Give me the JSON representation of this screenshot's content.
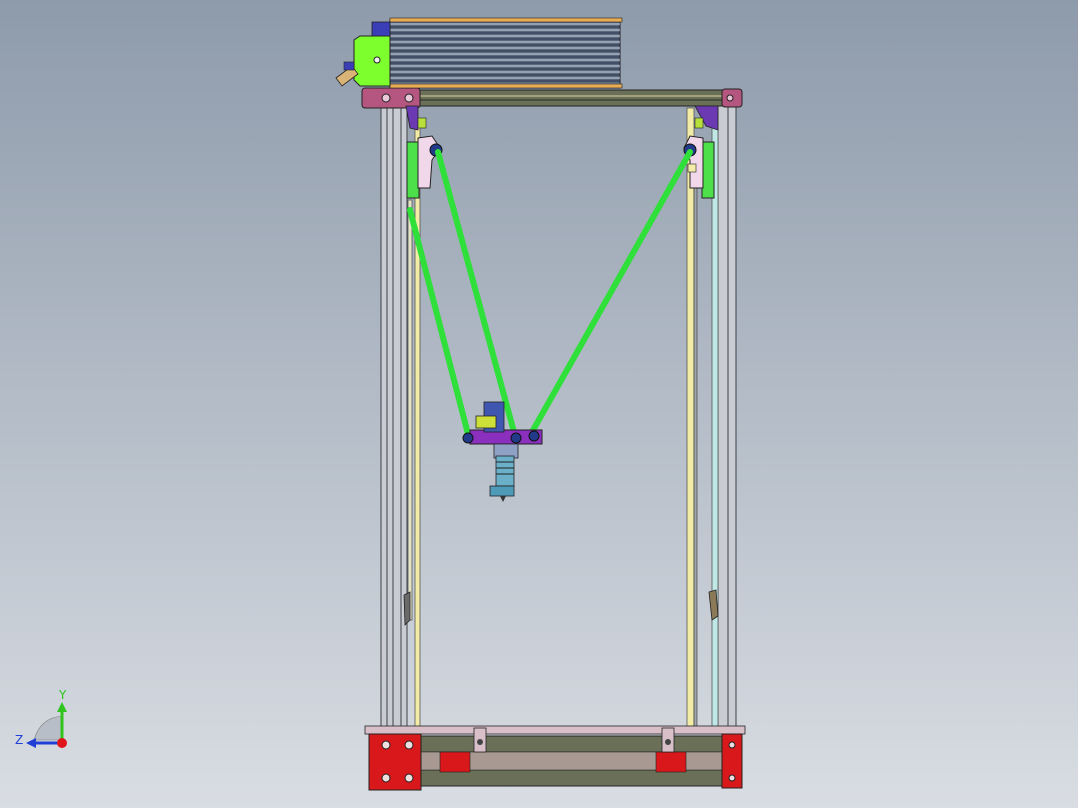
{
  "viewport": {
    "background_top": "#8e9bab",
    "background_bottom": "#d9dde3"
  },
  "triad": {
    "y_label": "Y",
    "z_label": "Z",
    "y_color": "#2fc41e",
    "z_color": "#1f3fd6",
    "x_color": "#e0161b"
  },
  "colors": {
    "arm": "#2fe03a",
    "arm_edge": "#116a18",
    "upright": "#c9ccd2",
    "upright_dark": "#3d4148",
    "rail": "#f2eca6",
    "rail_right": "#bfe8e6",
    "bracket_top": "#b4567f",
    "base": "#d8181b",
    "extrusion": "#6a7057",
    "carriage_green": "#4ee04a",
    "carriage_pink": "#f0d7ea",
    "effector": "#8b2fbf",
    "spool_body": "#5c6a80",
    "spool_edge": "#e8ad54",
    "spool_mount": "#7dff2e",
    "hotend": "#6ab0c9"
  }
}
